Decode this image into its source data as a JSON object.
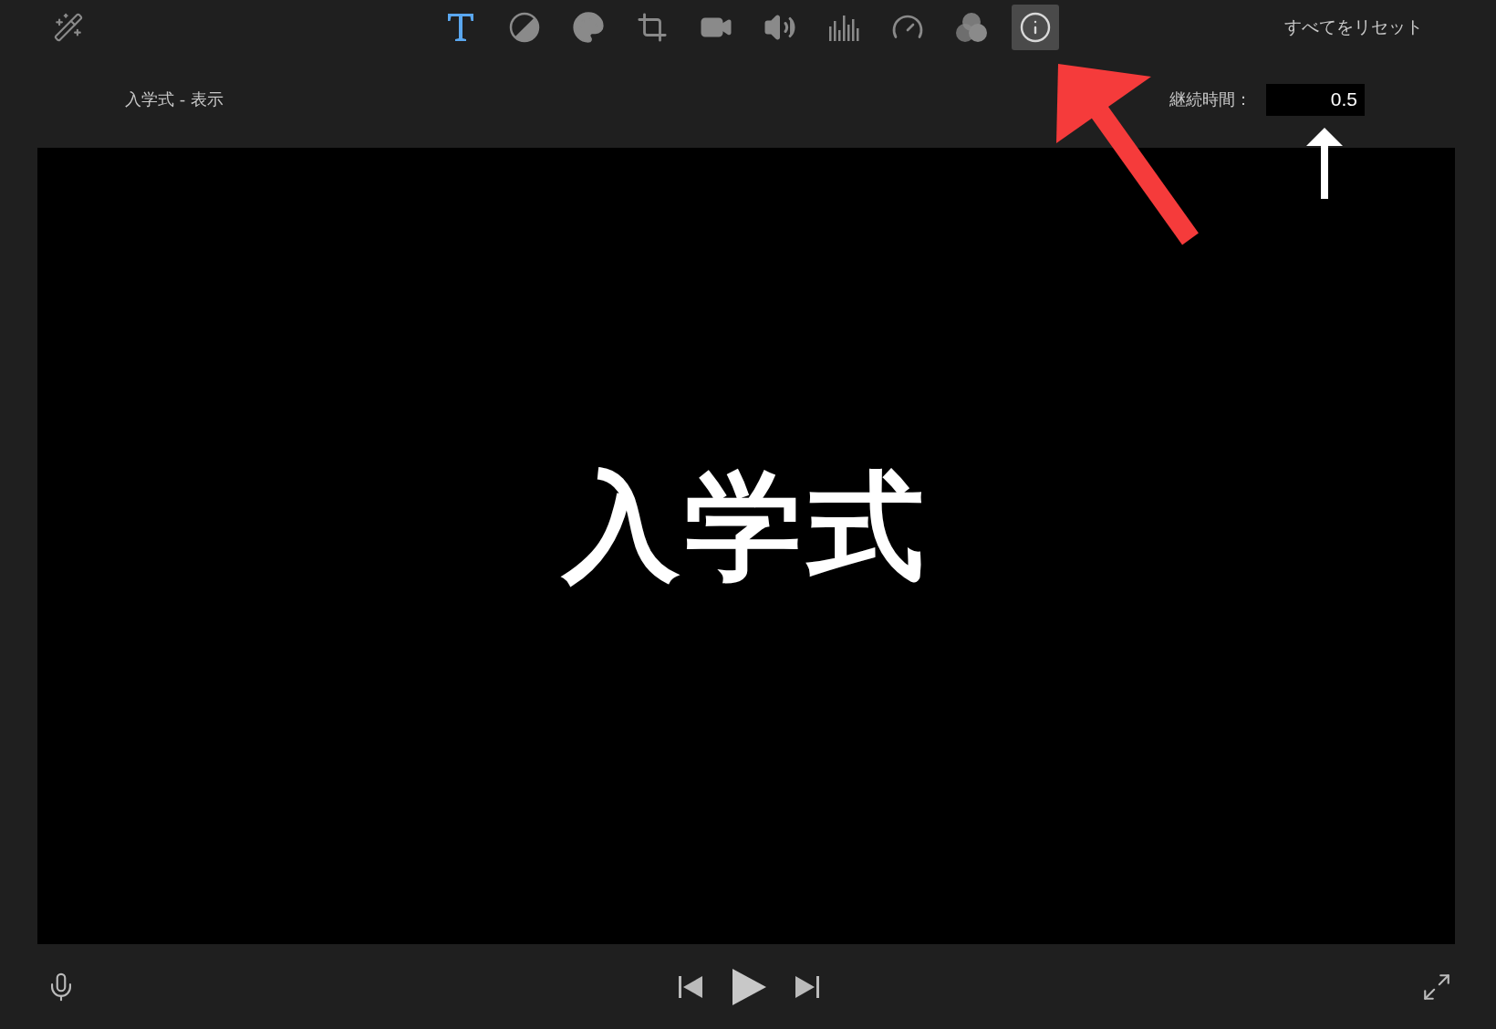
{
  "toolbar": {
    "tools": [
      {
        "kind": "text",
        "selected": false,
        "active": true
      },
      {
        "kind": "balance",
        "selected": false,
        "active": false
      },
      {
        "kind": "palette",
        "selected": false,
        "active": false
      },
      {
        "kind": "crop",
        "selected": false,
        "active": false
      },
      {
        "kind": "stabilize",
        "selected": false,
        "active": false
      },
      {
        "kind": "volume",
        "selected": false,
        "active": false
      },
      {
        "kind": "equalizer",
        "selected": false,
        "active": false
      },
      {
        "kind": "speed",
        "selected": false,
        "active": false
      },
      {
        "kind": "filter",
        "selected": false,
        "active": false
      },
      {
        "kind": "info",
        "selected": true,
        "active": false
      }
    ],
    "reset_button": "すべてをリセット"
  },
  "clip_title": "入学式 - 表示",
  "duration": {
    "label": "継続時間：",
    "value": "0.5"
  },
  "viewer": {
    "title_text": "入学式"
  }
}
